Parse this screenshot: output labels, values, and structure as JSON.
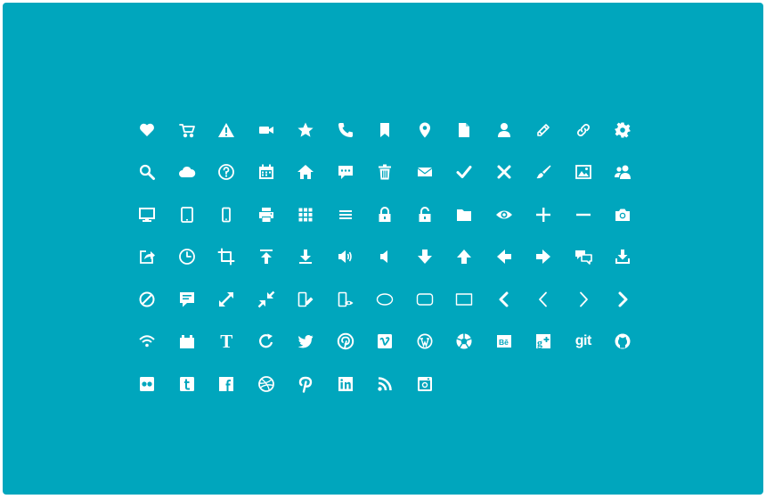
{
  "theme": {
    "background": "#00a6bd",
    "icon_color": "#ffffff"
  },
  "icon_grid": {
    "columns": 13,
    "icons": [
      "heart-icon",
      "cart-icon",
      "warning-icon",
      "video-camera-icon",
      "star-icon",
      "phone-icon",
      "bookmark-icon",
      "map-pin-icon",
      "document-icon",
      "user-icon",
      "pencil-icon",
      "link-icon",
      "gear-icon",
      "search-icon",
      "cloud-icon",
      "help-icon",
      "calendar-icon",
      "home-icon",
      "chat-bubble-icon",
      "trash-icon",
      "mail-icon",
      "checkmark-icon",
      "close-icon",
      "brush-icon",
      "image-icon",
      "users-icon",
      "monitor-icon",
      "tablet-icon",
      "phone-device-icon",
      "printer-icon",
      "grid-icon",
      "menu-icon",
      "lock-icon",
      "unlock-icon",
      "folder-icon",
      "eye-icon",
      "plus-icon",
      "minus-icon",
      "camera-icon",
      "share-icon",
      "clock-icon",
      "crop-icon",
      "upload-icon",
      "download-icon",
      "volume-up-icon",
      "volume-down-icon",
      "arrow-down-icon",
      "arrow-up-icon",
      "arrow-left-icon",
      "arrow-right-icon",
      "chat-icon",
      "install-icon",
      "block-icon",
      "comment-icon",
      "expand-icon",
      "compress-icon",
      "mobile-edit-icon",
      "mobile-view-icon",
      "ellipse-icon",
      "rounded-rect-icon",
      "rectangle-icon",
      "chevron-left-bold-icon",
      "chevron-left-icon",
      "chevron-right-icon",
      "chevron-right-bold-icon",
      "wifi-icon",
      "battery-icon",
      "text-icon",
      "refresh-icon",
      "twitter-icon",
      "pinterest-icon",
      "vimeo-icon",
      "wordpress-icon",
      "picasa-icon",
      "behance-icon",
      "google-plus-icon",
      "git-icon",
      "github-icon",
      "flickr-icon",
      "tumblr-icon",
      "facebook-icon",
      "dribbble-icon",
      "pinterest-p-icon",
      "linkedin-icon",
      "rss-icon",
      "instagram-icon"
    ]
  }
}
